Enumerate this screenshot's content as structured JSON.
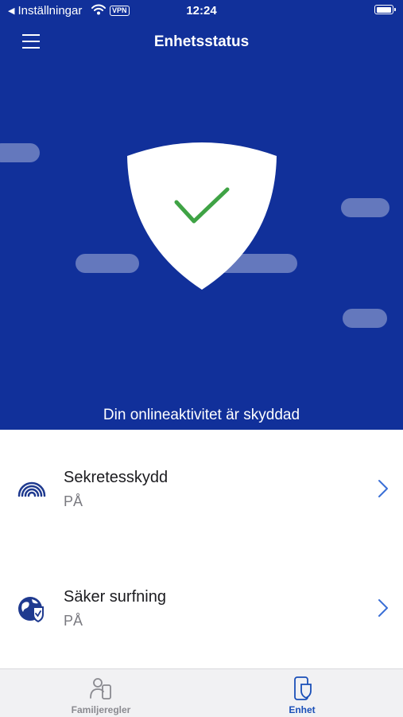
{
  "status_bar": {
    "back_label": "Inställningar",
    "vpn": "VPN",
    "time": "12:24",
    "battery_level": 0.95
  },
  "header": {
    "title": "Enhetsstatus",
    "menu_icon": "hamburger-menu-icon"
  },
  "hero": {
    "caption": "Din onlineaktivitet är skyddad",
    "icon": "shield-checkmark-icon",
    "colors": {
      "background": "#11309a",
      "shield": "#ffffff",
      "check": "#3fa345"
    }
  },
  "features": [
    {
      "title": "Sekretesskydd",
      "status": "PÅ",
      "icon": "signal-waves-icon"
    },
    {
      "title": "Säker surfning",
      "status": "PÅ",
      "icon": "globe-shield-icon"
    }
  ],
  "tabbar": {
    "tabs": [
      {
        "label": "Familjeregler",
        "icon": "family-rules-icon",
        "active": false
      },
      {
        "label": "Enhet",
        "icon": "device-shield-icon",
        "active": true
      }
    ],
    "colors": {
      "active": "#1a4fb8",
      "inactive": "#8a8a90"
    }
  },
  "colors": {
    "accent": "#1a4fb8",
    "chevron": "#3a6fd6"
  }
}
